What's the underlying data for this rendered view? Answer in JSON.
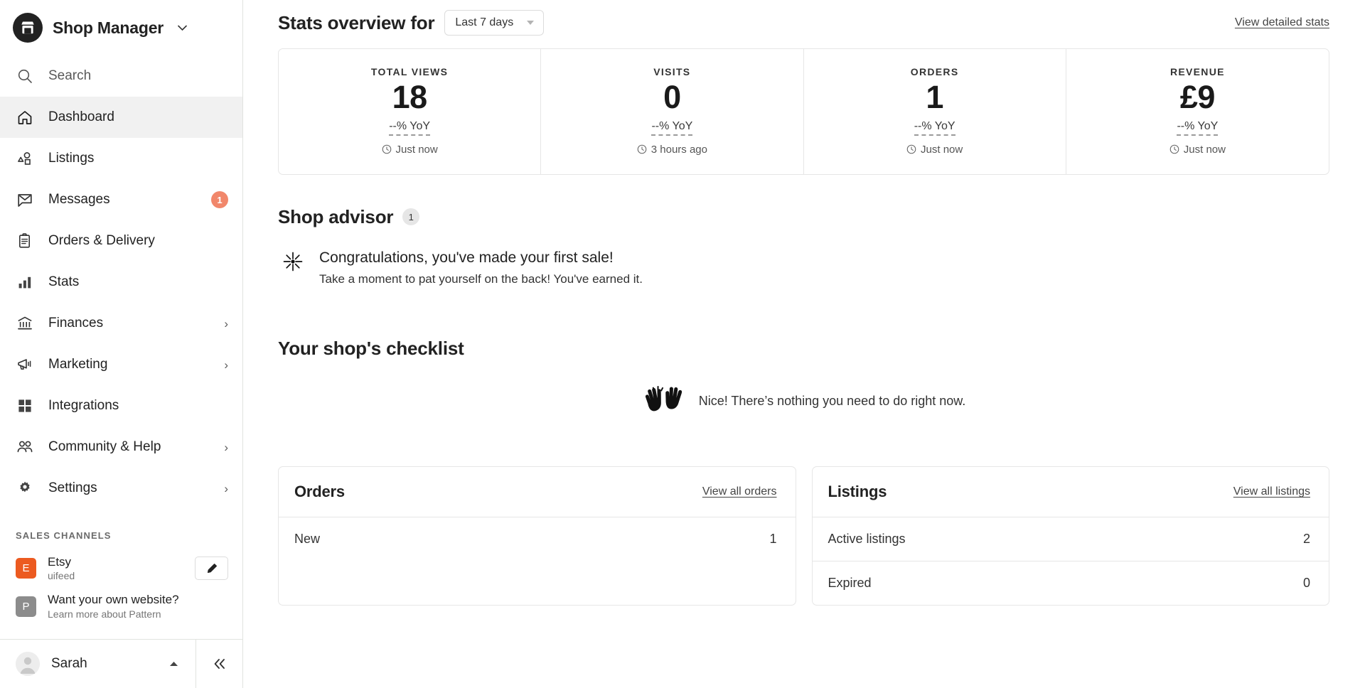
{
  "sidebar": {
    "brand": {
      "title": "Shop Manager",
      "icon": "shop-icon",
      "caret": "▾"
    },
    "nav": [
      {
        "label": "Search",
        "icon": "search-icon",
        "muted": true
      },
      {
        "label": "Dashboard",
        "icon": "home-icon",
        "active": true
      },
      {
        "label": "Listings",
        "icon": "listings-icon"
      },
      {
        "label": "Messages",
        "icon": "mail-icon",
        "badge": "1"
      },
      {
        "label": "Orders & Delivery",
        "icon": "clipboard-icon"
      },
      {
        "label": "Stats",
        "icon": "bar-chart-icon"
      },
      {
        "label": "Finances",
        "icon": "bank-icon",
        "chevron": "›"
      },
      {
        "label": "Marketing",
        "icon": "megaphone-icon",
        "chevron": "›"
      },
      {
        "label": "Integrations",
        "icon": "grid-icon"
      },
      {
        "label": "Community & Help",
        "icon": "people-icon",
        "chevron": "›"
      },
      {
        "label": "Settings",
        "icon": "gear-icon",
        "chevron": "›"
      }
    ],
    "sales_channels_label": "Sales channels",
    "channels": [
      {
        "initial": "E",
        "color": "#ec5a20",
        "title": "Etsy",
        "subtitle": "uifeed",
        "action_icon": "pencil-icon"
      },
      {
        "initial": "P",
        "color": "#8c8c8c",
        "title": "Want your own website?",
        "subtitle": "Learn more about Pattern"
      }
    ],
    "user": {
      "name": "Sarah",
      "caret": "▲",
      "avatar_icon": "user-avatar-icon"
    },
    "collapse_icon": "double-chevron-left-icon"
  },
  "main": {
    "stats_overview": {
      "title": "Stats overview for",
      "period_value": "Last 7 days",
      "period_caret": "▾",
      "detailed_link": "View detailed stats",
      "cards": [
        {
          "label": "Total views",
          "value": "18",
          "yoy": "--% YoY",
          "time": "Just now",
          "time_icon": "clock-icon"
        },
        {
          "label": "Visits",
          "value": "0",
          "yoy": "--% YoY",
          "time": "3 hours ago",
          "time_icon": "clock-icon"
        },
        {
          "label": "Orders",
          "value": "1",
          "yoy": "--% YoY",
          "time": "Just now",
          "time_icon": "clock-icon"
        },
        {
          "label": "Revenue",
          "value": "£9",
          "yoy": "--% YoY",
          "time": "Just now",
          "time_icon": "clock-icon"
        }
      ]
    },
    "shop_advisor": {
      "title": "Shop advisor",
      "count": "1",
      "item": {
        "icon": "sparkle-icon",
        "heading": "Congratulations, you've made your first sale!",
        "body": "Take a moment to pat yourself on the back! You've earned it."
      }
    },
    "checklist": {
      "title": "Your shop's checklist",
      "empty_icon": "raising-hands-icon",
      "empty_message": "Nice! There’s nothing you need to do right now."
    },
    "panels": [
      {
        "title": "Orders",
        "link": "View all orders",
        "rows": [
          {
            "label": "New",
            "value": "1"
          }
        ]
      },
      {
        "title": "Listings",
        "link": "View all listings",
        "rows": [
          {
            "label": "Active listings",
            "value": "2"
          },
          {
            "label": "Expired",
            "value": "0"
          }
        ]
      }
    ]
  }
}
